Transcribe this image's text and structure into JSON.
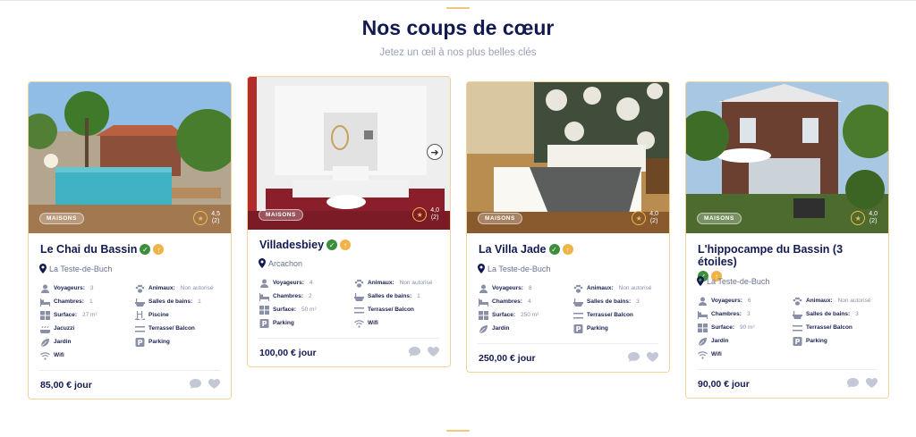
{
  "section": {
    "title": "Nos coups de cœur",
    "subtitle": "Jetez un œil à nos plus belles clés"
  },
  "colors": {
    "accent": "#f0c877",
    "navy": "#131a52",
    "verified": "#3c8e3c",
    "boost": "#f0b348"
  },
  "cards": [
    {
      "title": "Le Chai du Bassin",
      "badge": "MAISONS",
      "rating": "4,5",
      "reviews": "(2)",
      "location": "La Teste-de-Buch",
      "price": "85,00 € jour",
      "features": [
        {
          "label": "Voyageurs:",
          "value": "3",
          "icon": "person-icon"
        },
        {
          "label": "Animaux:",
          "value": "Non autorisé",
          "icon": "paw-icon"
        },
        {
          "label": "Chambres:",
          "value": "1",
          "icon": "bed-icon"
        },
        {
          "label": "Salles de bains:",
          "value": "1",
          "icon": "bath-icon"
        },
        {
          "label": "Surface:",
          "value": "27 m²",
          "icon": "surface-icon"
        },
        {
          "label": "Piscine",
          "value": "",
          "icon": "pool-icon"
        },
        {
          "label": "Jacuzzi",
          "value": "",
          "icon": "jacuzzi-icon"
        },
        {
          "label": "Terrasse/ Balcon",
          "value": "",
          "icon": "terrace-icon"
        },
        {
          "label": "Jardin",
          "value": "",
          "icon": "leaf-icon"
        },
        {
          "label": "Parking",
          "value": "",
          "icon": "parking-icon"
        },
        {
          "label": "Wifi",
          "value": "",
          "icon": "wifi-icon"
        }
      ]
    },
    {
      "title": "Villadesbiey",
      "badge": "MAISONS",
      "rating": "4,0",
      "reviews": "(2)",
      "location": "Arcachon",
      "price": "100,00 € jour",
      "features": [
        {
          "label": "Voyageurs:",
          "value": "4",
          "icon": "person-icon"
        },
        {
          "label": "Animaux:",
          "value": "Non autorisé",
          "icon": "paw-icon"
        },
        {
          "label": "Chambres:",
          "value": "2",
          "icon": "bed-icon"
        },
        {
          "label": "Salles de bains:",
          "value": "1",
          "icon": "bath-icon"
        },
        {
          "label": "Surface:",
          "value": "50 m²",
          "icon": "surface-icon"
        },
        {
          "label": "Terrasse/ Balcon",
          "value": "",
          "icon": "terrace-icon"
        },
        {
          "label": "Parking",
          "value": "",
          "icon": "parking-icon"
        },
        {
          "label": "Wifi",
          "value": "",
          "icon": "wifi-icon"
        }
      ]
    },
    {
      "title": "La Villa Jade",
      "badge": "MAISONS",
      "rating": "4,0",
      "reviews": "(2)",
      "location": "La Teste-de-Buch",
      "price": "250,00 € jour",
      "features": [
        {
          "label": "Voyageurs:",
          "value": "8",
          "icon": "person-icon"
        },
        {
          "label": "Animaux:",
          "value": "Non autorisé",
          "icon": "paw-icon"
        },
        {
          "label": "Chambres:",
          "value": "4",
          "icon": "bed-icon"
        },
        {
          "label": "Salles de bains:",
          "value": "3",
          "icon": "bath-icon"
        },
        {
          "label": "Surface:",
          "value": "250 m²",
          "icon": "surface-icon"
        },
        {
          "label": "Terrasse/ Balcon",
          "value": "",
          "icon": "terrace-icon"
        },
        {
          "label": "Jardin",
          "value": "",
          "icon": "leaf-icon"
        },
        {
          "label": "Parking",
          "value": "",
          "icon": "parking-icon"
        }
      ]
    },
    {
      "title": "L'hippocampe du Bassin (3 étoiles)",
      "badge": "MAISONS",
      "rating": "4,0",
      "reviews": "(2)",
      "location": "La Teste-de-Buch",
      "price": "90,00 € jour",
      "features": [
        {
          "label": "Voyageurs:",
          "value": "6",
          "icon": "person-icon"
        },
        {
          "label": "Animaux:",
          "value": "Non autorisé",
          "icon": "paw-icon"
        },
        {
          "label": "Chambres:",
          "value": "3",
          "icon": "bed-icon"
        },
        {
          "label": "Salles de bains:",
          "value": "3",
          "icon": "bath-icon"
        },
        {
          "label": "Surface:",
          "value": "90 m²",
          "icon": "surface-icon"
        },
        {
          "label": "Terrasse/ Balcon",
          "value": "",
          "icon": "terrace-icon"
        },
        {
          "label": "Jardin",
          "value": "",
          "icon": "leaf-icon"
        },
        {
          "label": "Parking",
          "value": "",
          "icon": "parking-icon"
        },
        {
          "label": "Wifi",
          "value": "",
          "icon": "wifi-icon"
        }
      ]
    }
  ]
}
